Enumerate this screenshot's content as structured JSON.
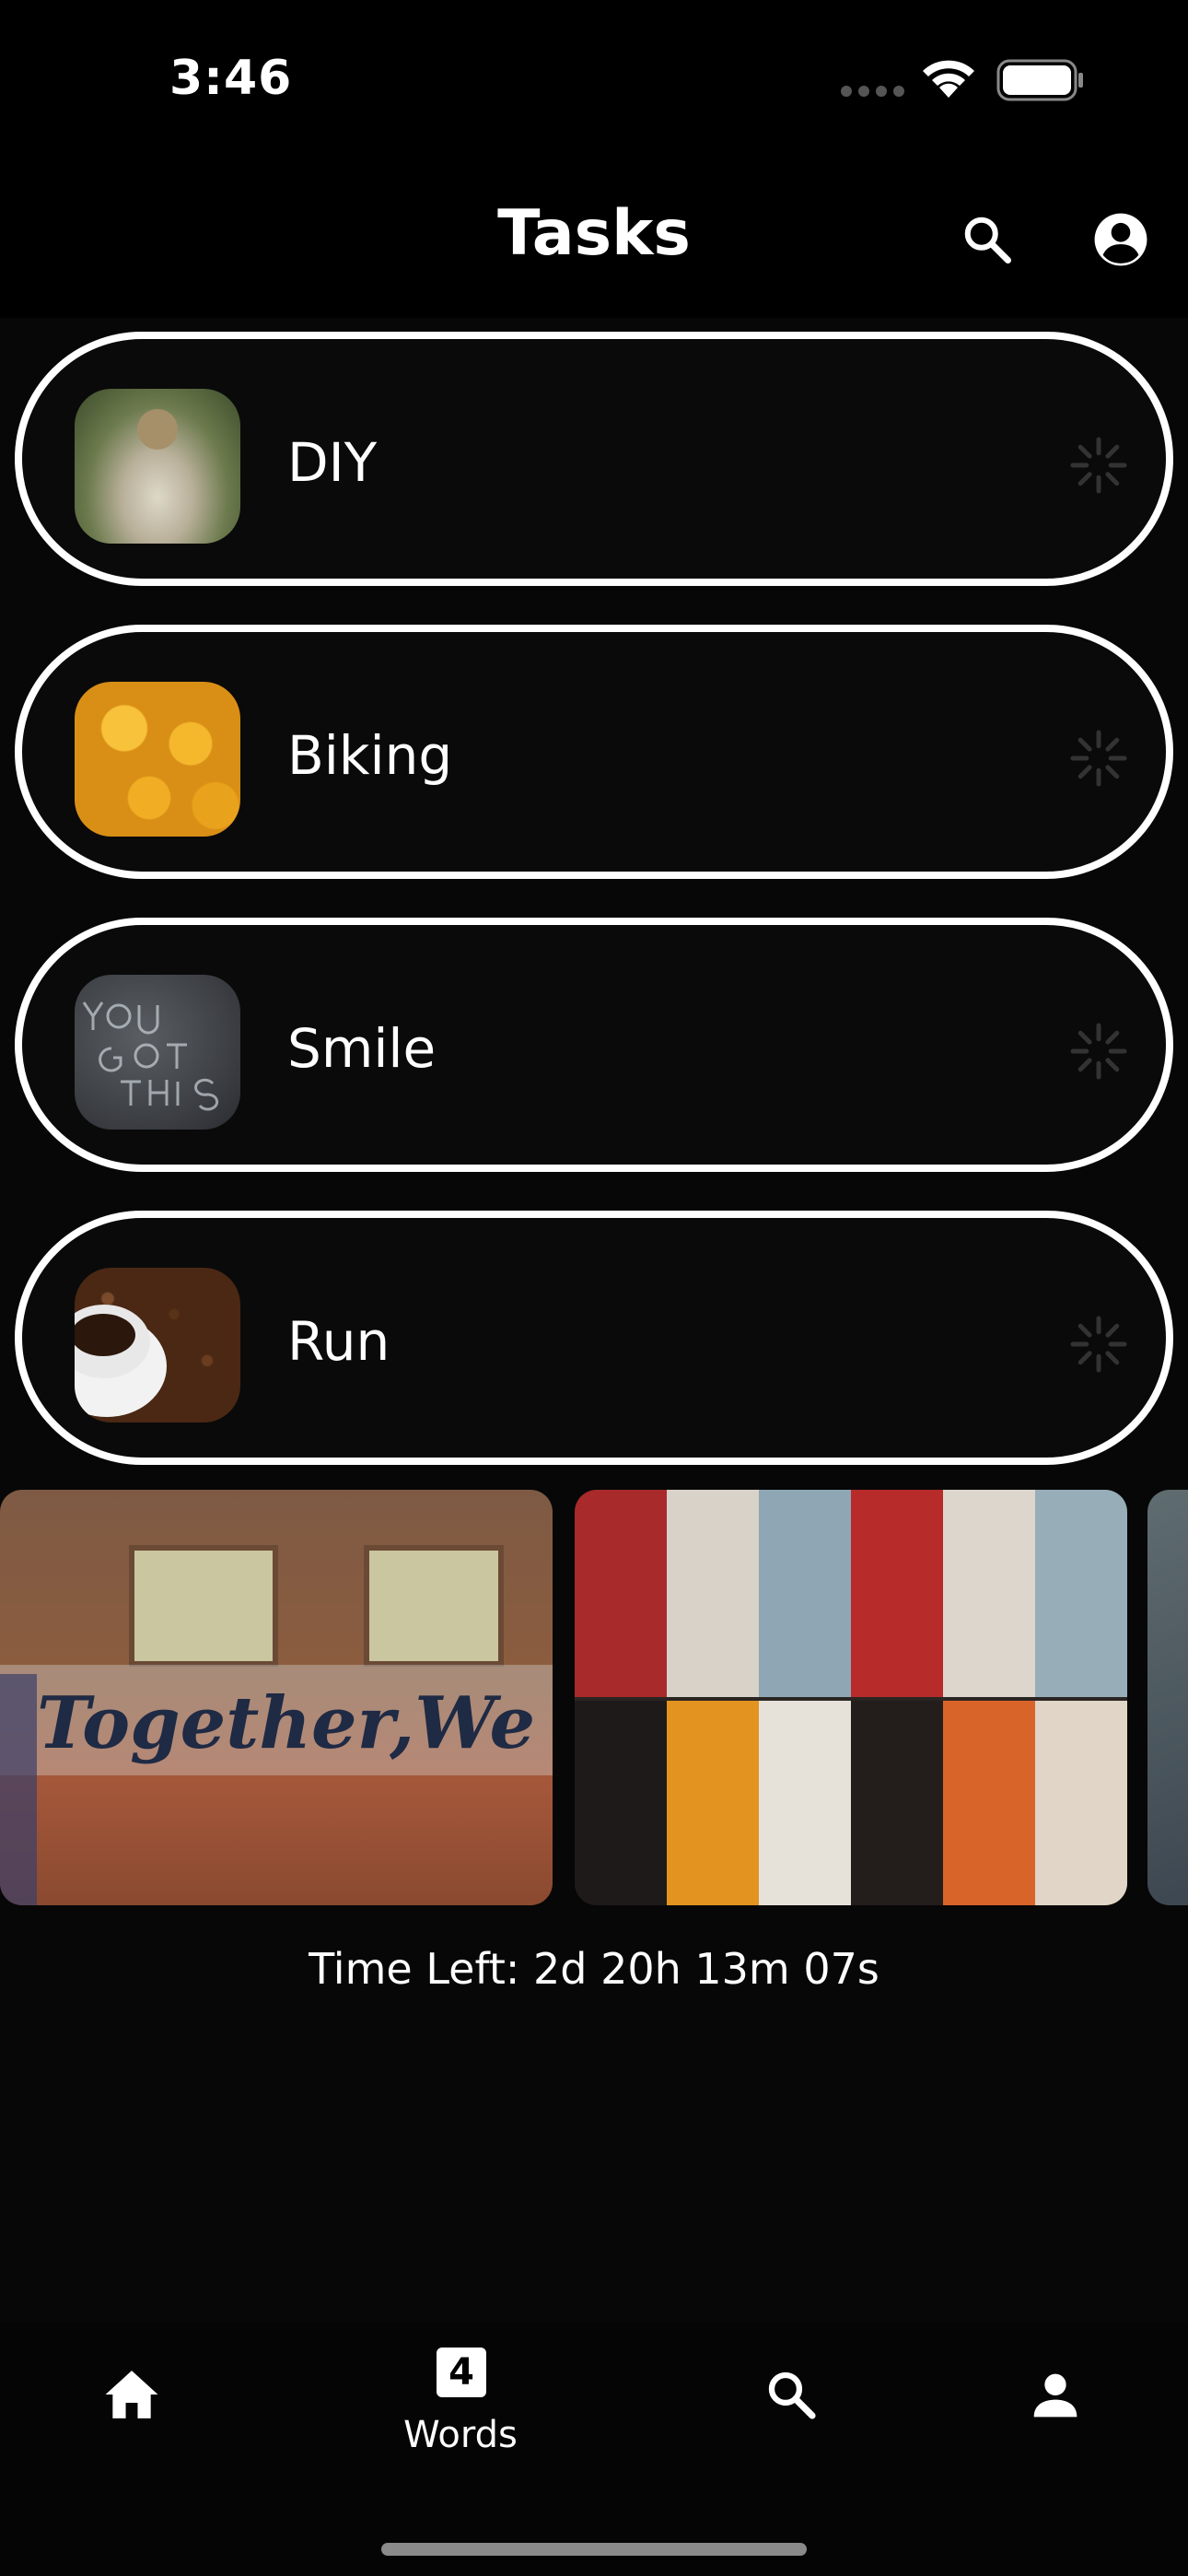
{
  "status_bar": {
    "time": "3:46",
    "icons": [
      "signal-dots-icon",
      "wifi-icon",
      "battery-icon"
    ]
  },
  "header": {
    "title": "Tasks",
    "icons": [
      "search-icon",
      "account-circle-icon"
    ]
  },
  "tasks": [
    {
      "label": "DIY",
      "thumbnail": "pug-in-blanket-photo"
    },
    {
      "label": "Biking",
      "thumbnail": "yellow-smiley-balls-photo"
    },
    {
      "label": "Smile",
      "thumbnail": "chalk-you-got-this-photo"
    },
    {
      "label": "Run",
      "thumbnail": "coffee-cup-beans-photo"
    }
  ],
  "carousel": [
    {
      "name": "brick-wall-graffiti-photo",
      "text": "Together,We Cre"
    },
    {
      "name": "colorful-lockers-photo"
    },
    {
      "name": "partial-photo-card"
    }
  ],
  "timer": {
    "text": "Time Left: 2d 20h 13m 07s"
  },
  "bottom_nav": {
    "items": [
      {
        "icon": "home-icon"
      },
      {
        "icon": "numbered-square-icon",
        "badge": "4",
        "label": "Words"
      },
      {
        "icon": "search-icon"
      },
      {
        "icon": "person-icon"
      }
    ]
  },
  "colors": {
    "background": "#070707",
    "pill_border": "#ffffff",
    "text": "#ffffff"
  }
}
